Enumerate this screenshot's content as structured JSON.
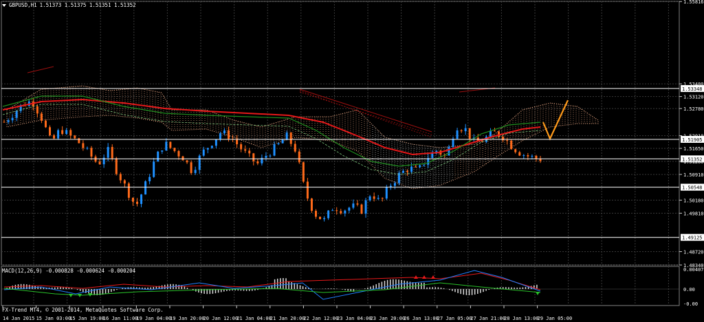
{
  "header": {
    "symbol_tf": "GBPUSD,H1",
    "ohlc": "1.51373 1.51375 1.51351 1.51352"
  },
  "macd": {
    "label": "MACD(12,26,9) -0.000828 -0.000624 -0.000204",
    "ticks": [
      "0.004074",
      "0.00",
      "-0.00"
    ]
  },
  "copyright": "FX-Trend MT4, © 2001-2014, MetaQuotes Software Corp.",
  "price_axis": {
    "ticks": [
      "1.55816",
      "1.53480",
      "1.53120",
      "1.52780",
      "1.52010",
      "1.51650",
      "1.51280",
      "1.50910",
      "1.50180",
      "1.49810",
      "1.48720",
      "1.48340"
    ],
    "level_lines": [
      "1.53348",
      "1.51905",
      "1.51352",
      "1.50548",
      "1.49125"
    ]
  },
  "time_axis": {
    "ticks": [
      "14 Jan 2015",
      "15 Jan 03:00",
      "15 Jan 19:00",
      "16 Jan 11:00",
      "19 Jan 04:00",
      "19 Jan 20:00",
      "20 Jan 12:00",
      "21 Jan 04:00",
      "21 Jan 20:00",
      "22 Jan 12:00",
      "23 Jan 04:00",
      "23 Jan 20:00",
      "26 Jan 13:00",
      "27 Jan 05:00",
      "27 Jan 21:00",
      "28 Jan 13:00",
      "29 Jan 05:00"
    ]
  },
  "colors": {
    "background": "#000000",
    "grid": "#3a3a3a",
    "bull_candle": "#1e90ff",
    "bear_candle": "#ff6a1a",
    "ma_red": "#e8191a",
    "ma_green": "#1f8f1f",
    "ma_green_light": "#7ec87e",
    "cloud_a": "#f5b08a",
    "cloud_b": "#dddddd",
    "forecast": "#ff9a1a",
    "level_line": "#ffffff"
  },
  "chart_data": {
    "type": "candlestick",
    "symbol": "GBPUSD",
    "timeframe": "H1",
    "last_price": 1.51352,
    "y_range": [
      1.4834,
      1.5582
    ],
    "close_path": [
      1.524,
      1.5265,
      1.529,
      1.53,
      1.525,
      1.518,
      1.522,
      1.52,
      1.518,
      1.515,
      1.512,
      1.516,
      1.51,
      1.505,
      1.5,
      1.506,
      1.513,
      1.518,
      1.516,
      1.514,
      1.51,
      1.515,
      1.518,
      1.521,
      1.52,
      1.517,
      1.514,
      1.512,
      1.515,
      1.517,
      1.52,
      1.516,
      1.504,
      1.498,
      1.496,
      1.5,
      1.499,
      1.5,
      1.499,
      1.504,
      1.501,
      1.506,
      1.509,
      1.511,
      1.51,
      1.514,
      1.516,
      1.514,
      1.523,
      1.522,
      1.518,
      1.519,
      1.521,
      1.52,
      1.517,
      1.515,
      1.514,
      1.5135
    ]
  }
}
